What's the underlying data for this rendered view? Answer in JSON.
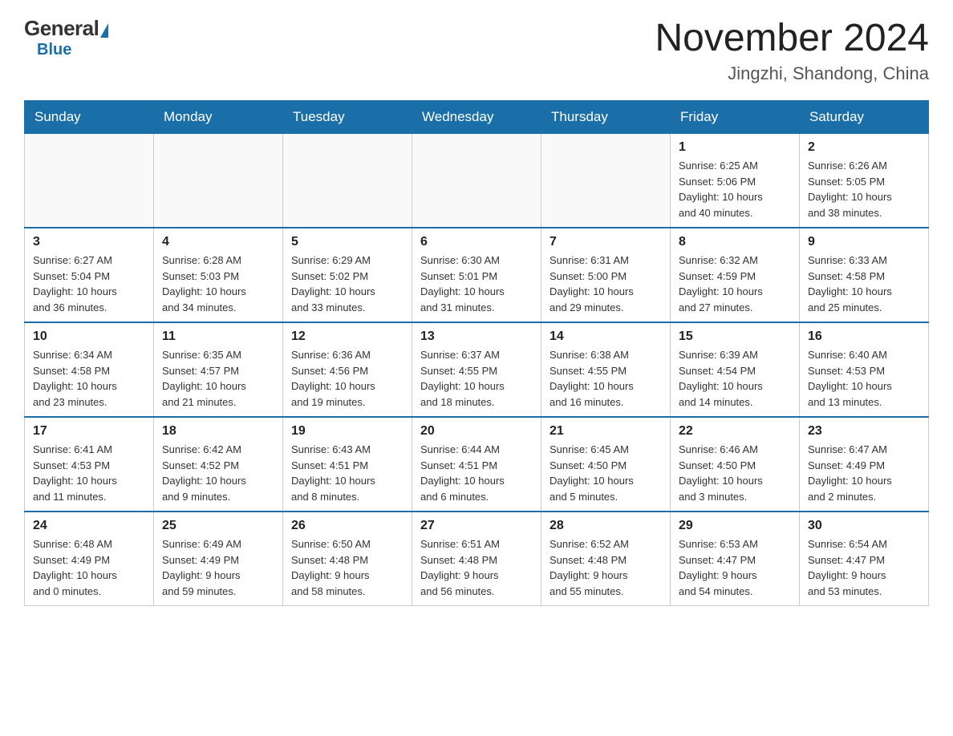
{
  "logo": {
    "general": "General",
    "blue": "Blue"
  },
  "title": "November 2024",
  "location": "Jingzhi, Shandong, China",
  "weekdays": [
    "Sunday",
    "Monday",
    "Tuesday",
    "Wednesday",
    "Thursday",
    "Friday",
    "Saturday"
  ],
  "weeks": [
    [
      {
        "day": "",
        "info": ""
      },
      {
        "day": "",
        "info": ""
      },
      {
        "day": "",
        "info": ""
      },
      {
        "day": "",
        "info": ""
      },
      {
        "day": "",
        "info": ""
      },
      {
        "day": "1",
        "info": "Sunrise: 6:25 AM\nSunset: 5:06 PM\nDaylight: 10 hours\nand 40 minutes."
      },
      {
        "day": "2",
        "info": "Sunrise: 6:26 AM\nSunset: 5:05 PM\nDaylight: 10 hours\nand 38 minutes."
      }
    ],
    [
      {
        "day": "3",
        "info": "Sunrise: 6:27 AM\nSunset: 5:04 PM\nDaylight: 10 hours\nand 36 minutes."
      },
      {
        "day": "4",
        "info": "Sunrise: 6:28 AM\nSunset: 5:03 PM\nDaylight: 10 hours\nand 34 minutes."
      },
      {
        "day": "5",
        "info": "Sunrise: 6:29 AM\nSunset: 5:02 PM\nDaylight: 10 hours\nand 33 minutes."
      },
      {
        "day": "6",
        "info": "Sunrise: 6:30 AM\nSunset: 5:01 PM\nDaylight: 10 hours\nand 31 minutes."
      },
      {
        "day": "7",
        "info": "Sunrise: 6:31 AM\nSunset: 5:00 PM\nDaylight: 10 hours\nand 29 minutes."
      },
      {
        "day": "8",
        "info": "Sunrise: 6:32 AM\nSunset: 4:59 PM\nDaylight: 10 hours\nand 27 minutes."
      },
      {
        "day": "9",
        "info": "Sunrise: 6:33 AM\nSunset: 4:58 PM\nDaylight: 10 hours\nand 25 minutes."
      }
    ],
    [
      {
        "day": "10",
        "info": "Sunrise: 6:34 AM\nSunset: 4:58 PM\nDaylight: 10 hours\nand 23 minutes."
      },
      {
        "day": "11",
        "info": "Sunrise: 6:35 AM\nSunset: 4:57 PM\nDaylight: 10 hours\nand 21 minutes."
      },
      {
        "day": "12",
        "info": "Sunrise: 6:36 AM\nSunset: 4:56 PM\nDaylight: 10 hours\nand 19 minutes."
      },
      {
        "day": "13",
        "info": "Sunrise: 6:37 AM\nSunset: 4:55 PM\nDaylight: 10 hours\nand 18 minutes."
      },
      {
        "day": "14",
        "info": "Sunrise: 6:38 AM\nSunset: 4:55 PM\nDaylight: 10 hours\nand 16 minutes."
      },
      {
        "day": "15",
        "info": "Sunrise: 6:39 AM\nSunset: 4:54 PM\nDaylight: 10 hours\nand 14 minutes."
      },
      {
        "day": "16",
        "info": "Sunrise: 6:40 AM\nSunset: 4:53 PM\nDaylight: 10 hours\nand 13 minutes."
      }
    ],
    [
      {
        "day": "17",
        "info": "Sunrise: 6:41 AM\nSunset: 4:53 PM\nDaylight: 10 hours\nand 11 minutes."
      },
      {
        "day": "18",
        "info": "Sunrise: 6:42 AM\nSunset: 4:52 PM\nDaylight: 10 hours\nand 9 minutes."
      },
      {
        "day": "19",
        "info": "Sunrise: 6:43 AM\nSunset: 4:51 PM\nDaylight: 10 hours\nand 8 minutes."
      },
      {
        "day": "20",
        "info": "Sunrise: 6:44 AM\nSunset: 4:51 PM\nDaylight: 10 hours\nand 6 minutes."
      },
      {
        "day": "21",
        "info": "Sunrise: 6:45 AM\nSunset: 4:50 PM\nDaylight: 10 hours\nand 5 minutes."
      },
      {
        "day": "22",
        "info": "Sunrise: 6:46 AM\nSunset: 4:50 PM\nDaylight: 10 hours\nand 3 minutes."
      },
      {
        "day": "23",
        "info": "Sunrise: 6:47 AM\nSunset: 4:49 PM\nDaylight: 10 hours\nand 2 minutes."
      }
    ],
    [
      {
        "day": "24",
        "info": "Sunrise: 6:48 AM\nSunset: 4:49 PM\nDaylight: 10 hours\nand 0 minutes."
      },
      {
        "day": "25",
        "info": "Sunrise: 6:49 AM\nSunset: 4:49 PM\nDaylight: 9 hours\nand 59 minutes."
      },
      {
        "day": "26",
        "info": "Sunrise: 6:50 AM\nSunset: 4:48 PM\nDaylight: 9 hours\nand 58 minutes."
      },
      {
        "day": "27",
        "info": "Sunrise: 6:51 AM\nSunset: 4:48 PM\nDaylight: 9 hours\nand 56 minutes."
      },
      {
        "day": "28",
        "info": "Sunrise: 6:52 AM\nSunset: 4:48 PM\nDaylight: 9 hours\nand 55 minutes."
      },
      {
        "day": "29",
        "info": "Sunrise: 6:53 AM\nSunset: 4:47 PM\nDaylight: 9 hours\nand 54 minutes."
      },
      {
        "day": "30",
        "info": "Sunrise: 6:54 AM\nSunset: 4:47 PM\nDaylight: 9 hours\nand 53 minutes."
      }
    ]
  ]
}
